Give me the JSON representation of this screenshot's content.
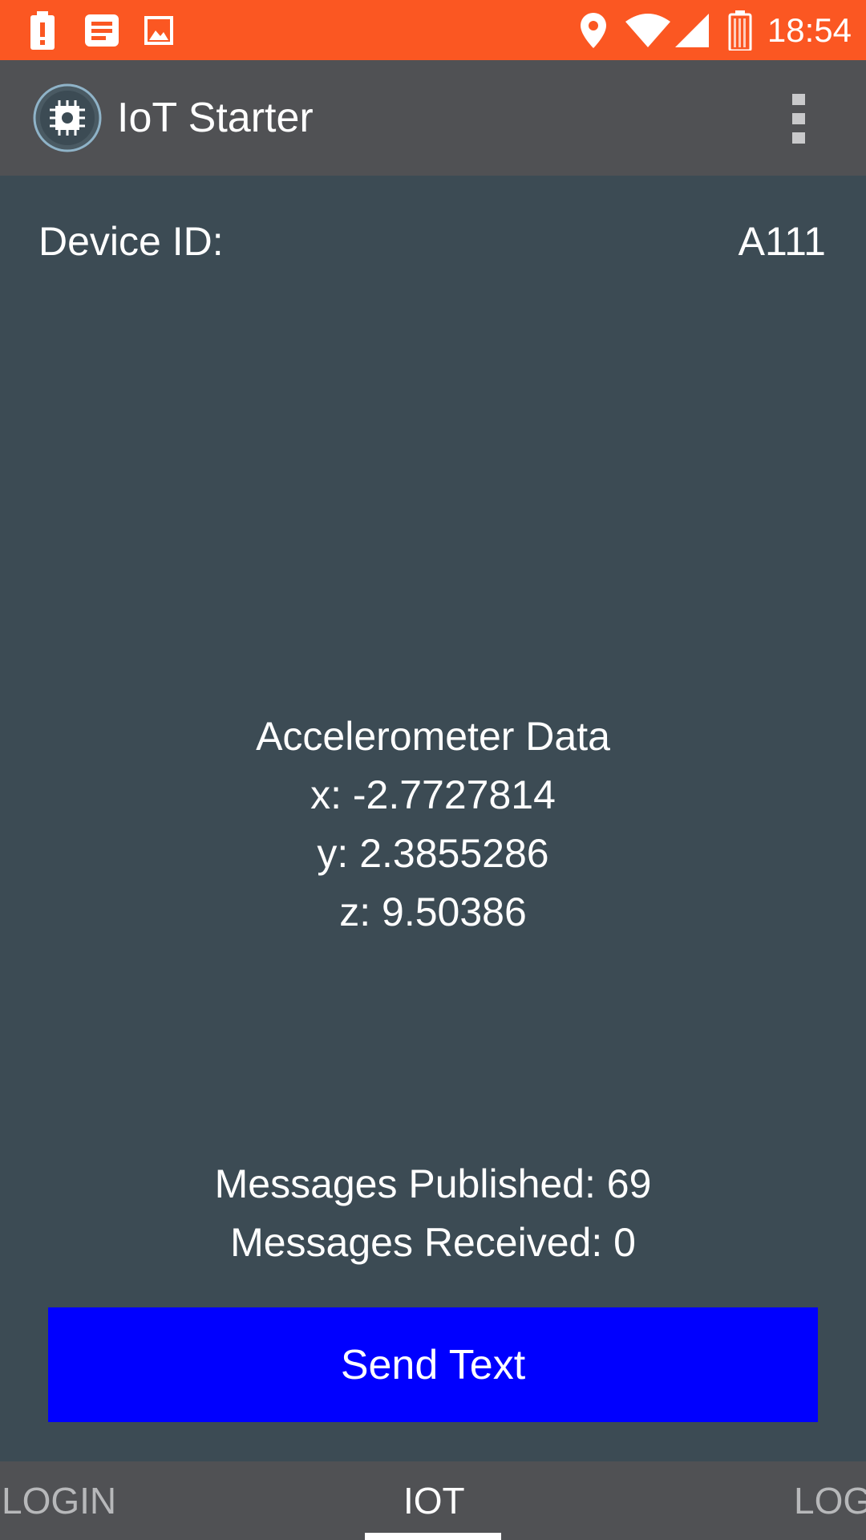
{
  "status_bar": {
    "time": "18:54",
    "background": "#fb5722",
    "left_icons": [
      "battery-alert-icon",
      "notification-list-icon",
      "image-icon"
    ],
    "right_icons": [
      "location-pin-icon",
      "wifi-icon",
      "cell-signal-icon",
      "battery-icon"
    ]
  },
  "app_bar": {
    "title": "IoT Starter",
    "logo_icon": "chip-icon",
    "menu_icon": "overflow-menu-icon"
  },
  "device": {
    "label": "Device ID:",
    "value": "A111"
  },
  "accelerometer": {
    "heading": "Accelerometer Data",
    "x": "x: -2.7727814",
    "y": "y: 2.3855286",
    "z": "z: 9.50386"
  },
  "messages": {
    "published": "Messages Published: 69",
    "received": "Messages Received: 0"
  },
  "send_button": {
    "label": "Send Text",
    "color": "#0000ff"
  },
  "tabs": [
    {
      "label": "LOGIN",
      "active": false
    },
    {
      "label": "IOT",
      "active": true
    },
    {
      "label": "LOG",
      "active": false
    }
  ],
  "colors": {
    "background": "#3c4b54",
    "app_bar": "#505154"
  }
}
